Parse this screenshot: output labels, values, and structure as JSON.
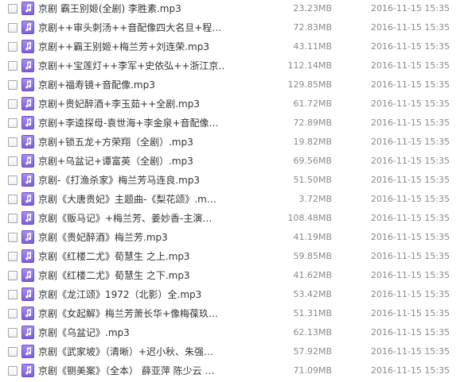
{
  "icon": "music-file-icon",
  "colors": {
    "icon_fill": "#8a6fe6",
    "name_text": "#333333",
    "meta_text": "#8a8a8a"
  },
  "files": [
    {
      "name": "京剧 霸王别姬(全剧) 李胜素.mp3",
      "size": "23.23MB",
      "date": "2016-11-15 15:35"
    },
    {
      "name": "京剧++审头刺汤++音配像四大名旦+程…",
      "size": "72.83MB",
      "date": "2016-11-15 15:35"
    },
    {
      "name": "京剧++霸王别姬+梅兰芳+刘连荣.mp3",
      "size": "43.11MB",
      "date": "2016-11-15 15:35"
    },
    {
      "name": "京剧++宝莲灯++李军+史依弘++浙江京…",
      "size": "112.14MB",
      "date": "2016-11-15 15:35"
    },
    {
      "name": "京剧+福寿镜+音配像.mp3",
      "size": "129.85MB",
      "date": "2016-11-15 15:35"
    },
    {
      "name": "京剧+贵妃醉酒+李玉茹++全剧.mp3",
      "size": "61.72MB",
      "date": "2016-11-15 15:35"
    },
    {
      "name": "京剧+李逵探母-袁世海+李金泉+音配像…",
      "size": "72.89MB",
      "date": "2016-11-15 15:35"
    },
    {
      "name": "京剧+锁五龙+方荣翔（全剧）.mp3",
      "size": "19.82MB",
      "date": "2016-11-15 15:35"
    },
    {
      "name": "京剧+乌盆记+谭富英（全剧）.mp3",
      "size": "69.56MB",
      "date": "2016-11-15 15:35"
    },
    {
      "name": "京剧-《打渔杀家》梅兰芳马连良.mp3",
      "size": "51.50MB",
      "date": "2016-11-15 15:35"
    },
    {
      "name": "京剧《大唐贵妃》主题曲-《梨花颂》.m…",
      "size": "3.72MB",
      "date": "2016-11-15 15:35"
    },
    {
      "name": "京剧《贩马记》+梅兰芳、姜妙香-主演…",
      "size": "108.48MB",
      "date": "2016-11-15 15:35"
    },
    {
      "name": "京剧《贵妃醉酒》梅兰芳.mp3",
      "size": "41.19MB",
      "date": "2016-11-15 15:35"
    },
    {
      "name": "京剧《红楼二尤》荀慧生 之上.mp3",
      "size": "59.85MB",
      "date": "2016-11-15 15:35"
    },
    {
      "name": "京剧《红楼二尤》荀慧生 之下.mp3",
      "size": "41.62MB",
      "date": "2016-11-15 15:35"
    },
    {
      "name": "京剧《龙江颂》1972（北影）全.mp3",
      "size": "53.42MB",
      "date": "2016-11-15 15:35"
    },
    {
      "name": "京剧《女起解》梅兰芳萧长华+像梅葆玖…",
      "size": "51.31MB",
      "date": "2016-11-15 15:35"
    },
    {
      "name": "京剧《乌盆记》.mp3",
      "size": "62.13MB",
      "date": "2016-11-15 15:35"
    },
    {
      "name": "京剧《武家坡》（清晰）+迟小秋、朱强…",
      "size": "57.92MB",
      "date": "2016-11-15 15:35"
    },
    {
      "name": "京剧《铡美案》（全本） 薛亚萍 陈少云 …",
      "size": "71.09MB",
      "date": "2016-11-15 15:35"
    }
  ]
}
